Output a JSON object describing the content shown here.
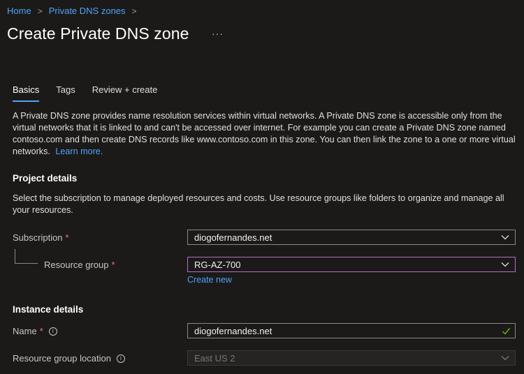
{
  "breadcrumb": {
    "home": "Home",
    "parent": "Private DNS zones",
    "sep": ">"
  },
  "page": {
    "title": "Create Private DNS zone",
    "more": "···"
  },
  "tabs": [
    {
      "label": "Basics",
      "active": true
    },
    {
      "label": "Tags",
      "active": false
    },
    {
      "label": "Review + create",
      "active": false
    }
  ],
  "description": {
    "text": "A Private DNS zone provides name resolution services within virtual networks. A Private DNS zone is accessible only from the virtual networks that it is linked to and can't be accessed over internet. For example you can create a Private DNS zone named contoso.com and then create DNS records like www.contoso.com in this zone. You can then link the zone to a one or more virtual networks.",
    "link": "Learn more."
  },
  "project": {
    "heading": "Project details",
    "text": "Select the subscription to manage deployed resources and costs. Use resource groups like folders to organize and manage all your resources.",
    "subscription_label": "Subscription",
    "subscription_value": "diogofernandes.net",
    "rg_label": "Resource group",
    "rg_value": "RG-AZ-700",
    "create_new": "Create new",
    "required_mark": "*"
  },
  "instance": {
    "heading": "Instance details",
    "name_label": "Name",
    "name_value": "diogofernandes.net",
    "location_label": "Resource group location",
    "location_value": "East US 2",
    "info_glyph": "i"
  },
  "colors": {
    "accent": "#4fa3f7",
    "required": "#f1707b",
    "valid": "#6bb700",
    "focus": "#b46ec4"
  }
}
